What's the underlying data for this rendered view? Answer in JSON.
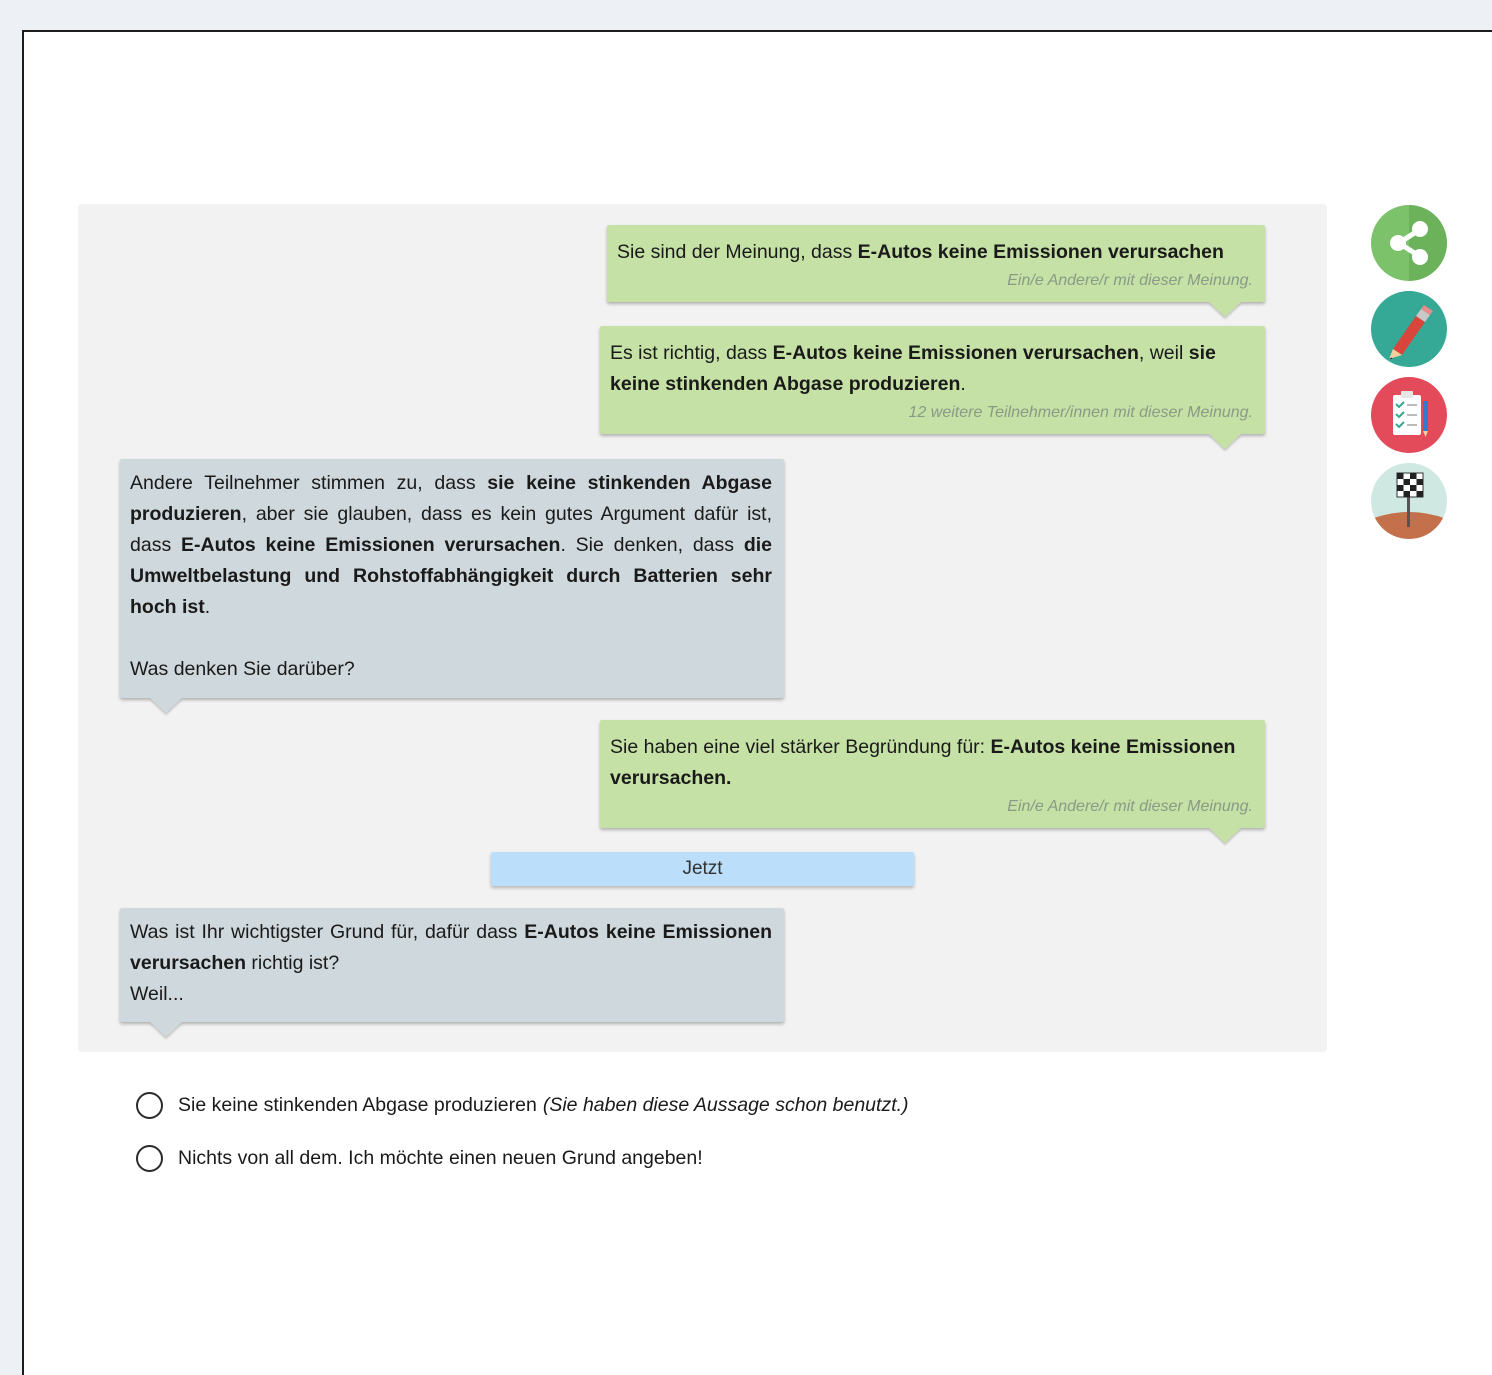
{
  "chat": {
    "messages": [
      {
        "side": "right",
        "pre": "Sie sind der Meinung, dass ",
        "bold": "E-Autos keine Emissionen verursachen",
        "meta": "Ein/e Andere/r mit dieser Meinung."
      },
      {
        "side": "right",
        "pre": "Es ist richtig, dass ",
        "bold1": "E-Autos keine Emissionen verursachen",
        "mid": ", weil ",
        "bold2": "sie keine stinkenden Abgase produzieren",
        "post": ".",
        "meta": "12 weitere Teilnehmer/innen mit dieser Meinung."
      },
      {
        "side": "left",
        "t1": "Andere Teilnehmer stimmen zu, dass ",
        "b1": "sie keine stinkenden Abgase produzieren",
        "t2": ", aber sie glauben, dass es kein gutes Argument dafür ist, dass ",
        "b2": "E-Autos keine Emissionen verursachen",
        "t3": ". Sie denken, dass ",
        "b3": "die Umweltbelastung und Rohstoffabhängigkeit durch Batterien sehr hoch ist",
        "t4": ".",
        "question": "Was denken Sie darüber?"
      },
      {
        "side": "right",
        "pre": "Sie haben eine viel stärker Begründung für: ",
        "bold": "E-Autos keine Emissionen verursachen.",
        "meta": "Ein/e Andere/r mit dieser Meinung."
      },
      {
        "side": "left",
        "t1": "Was ist Ihr wichtigster Grund für, dafür dass ",
        "b1": "E-Autos keine Emissionen verursachen",
        "t2": " richtig ist?",
        "t3": "Weil..."
      }
    ],
    "now_label": "Jetzt"
  },
  "side_icons": [
    "share-icon",
    "pencil-icon",
    "checklist-icon",
    "finish-flag-icon"
  ],
  "colors": {
    "own_bubble": "#c5e1a5",
    "system_bubble": "#cfd8dc",
    "now_bar": "#bbdefb",
    "share_green": "#7cc26b",
    "pencil_teal": "#35a896",
    "checklist_red": "#e34a5a"
  },
  "options": [
    {
      "label": "Sie keine stinkenden Abgase produzieren",
      "note": "(Sie haben diese Aussage schon benutzt.)"
    },
    {
      "label": "Nichts von all dem. Ich möchte einen neuen Grund angeben!",
      "note": ""
    }
  ]
}
